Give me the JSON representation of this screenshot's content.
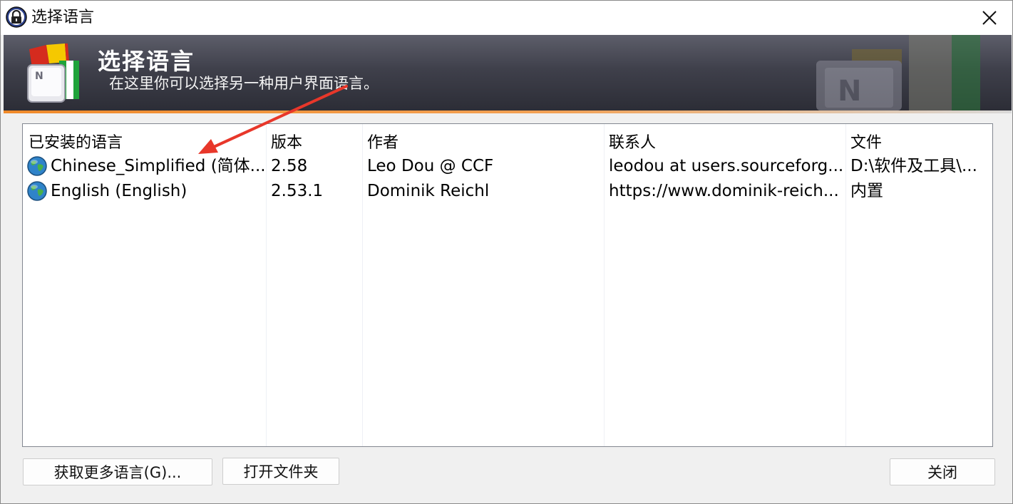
{
  "window": {
    "title": "选择语言"
  },
  "banner": {
    "title": "选择语言",
    "subtitle": "在这里你可以选择另一种用户界面语言。"
  },
  "table": {
    "columns": [
      "已安装的语言",
      "版本",
      "作者",
      "联系人",
      "文件"
    ],
    "rows": [
      {
        "language": "Chinese_Simplified (简体...",
        "version": "2.58",
        "author": "Leo Dou @ CCF",
        "contact": "leodou at users.sourceforg...",
        "file": "D:\\软件及工具\\..."
      },
      {
        "language": "English (English)",
        "version": "2.53.1",
        "author": "Dominik Reichl",
        "contact": "https://www.dominik-reich...",
        "file": "内置"
      }
    ]
  },
  "buttons": {
    "get_more": "获取更多语言(G)...",
    "open_folder": "打开文件夹",
    "close": "关闭"
  },
  "icons": {
    "title": "keepass-lock-icon",
    "banner": "language-flag-keyboard-icon",
    "row": "globe-icon",
    "close": "close-icon",
    "annotation": "red-arrow-annotation"
  },
  "colors": {
    "annotation_arrow": "#e8372a",
    "banner_accent": "#f08a2a"
  }
}
